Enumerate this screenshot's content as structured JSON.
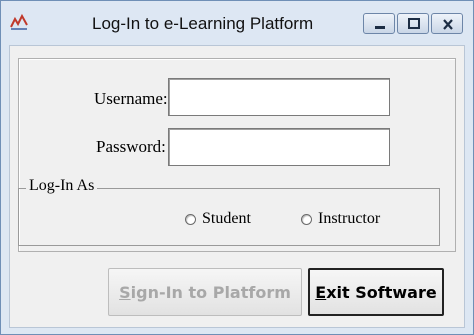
{
  "window": {
    "title": "Log-In to e-Learning Platform",
    "icon": "app-icon",
    "controls": {
      "minimize": "minimize-icon",
      "maximize": "maximize-icon",
      "close": "close-icon"
    }
  },
  "form": {
    "username_label": "Username:",
    "username_value": "",
    "password_label": "Password:",
    "password_value": ""
  },
  "login_as": {
    "legend": "Log-In As",
    "options": [
      {
        "label": "Student",
        "selected": false
      },
      {
        "label": "Instructor",
        "selected": false
      }
    ]
  },
  "buttons": {
    "signin_mnemonic": "S",
    "signin_rest": "ign-In to Platform",
    "signin_enabled": false,
    "exit_mnemonic": "E",
    "exit_rest": "xit Software"
  },
  "colors": {
    "frame": "#dde7f3",
    "client": "#f0f0f0",
    "disabled_text": "#a8a8a8"
  }
}
